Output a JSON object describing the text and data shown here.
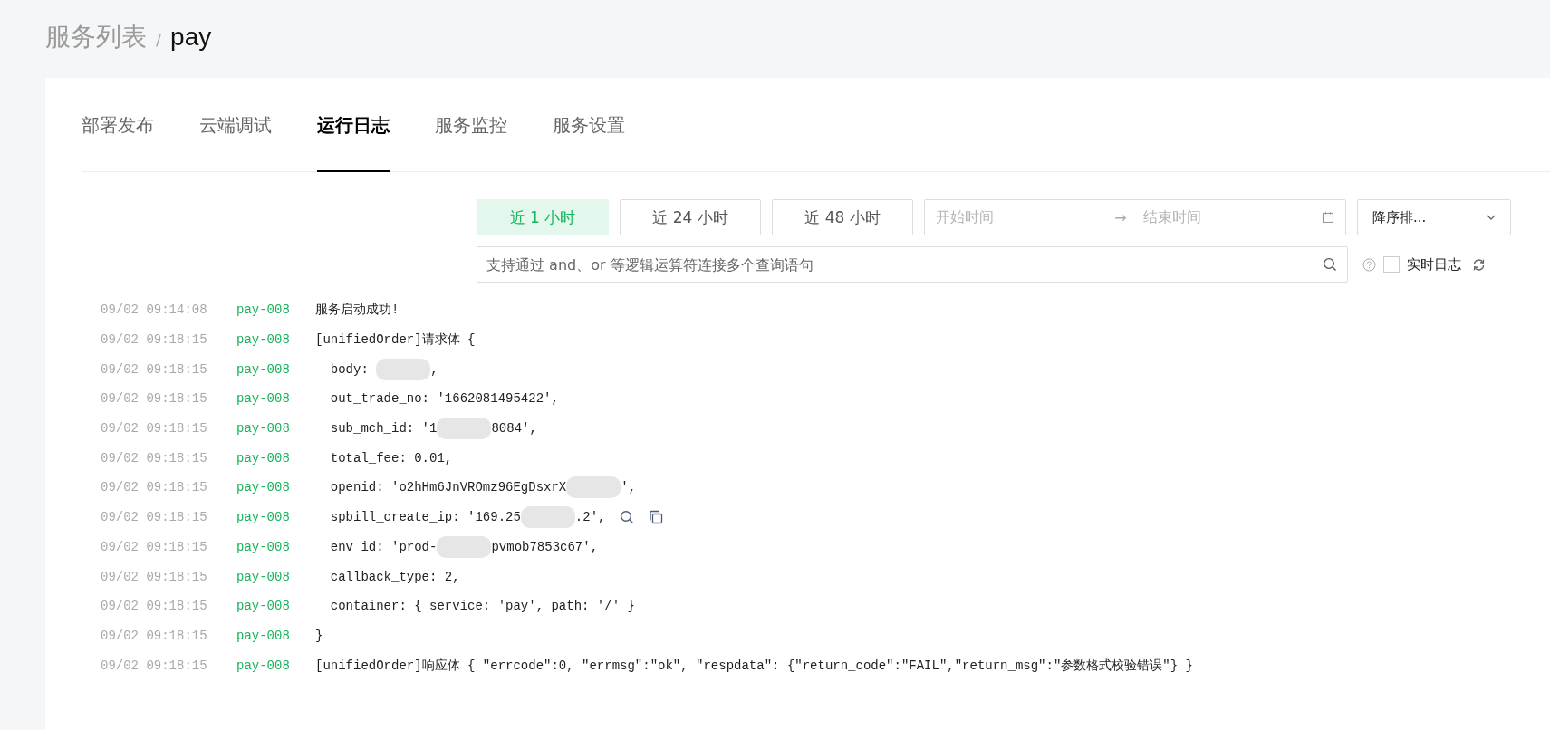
{
  "breadcrumb": {
    "parent": "服务列表",
    "separator": "/",
    "current": "pay"
  },
  "tabs": [
    {
      "label": "部署发布",
      "selected": false
    },
    {
      "label": "云端调试",
      "selected": false
    },
    {
      "label": "运行日志",
      "selected": true
    },
    {
      "label": "服务监控",
      "selected": false
    },
    {
      "label": "服务设置",
      "selected": false
    }
  ],
  "ranges": [
    {
      "label": "近 1 小时",
      "selected": true
    },
    {
      "label": "近 24 小时",
      "selected": false
    },
    {
      "label": "近 48 小时",
      "selected": false
    }
  ],
  "date_range": {
    "start_placeholder": "开始时间",
    "arrow": "→",
    "end_placeholder": "结束时间"
  },
  "sort": {
    "value": "降序排..."
  },
  "search": {
    "placeholder": "支持通过 and、or 等逻辑运算符连接多个查询语句"
  },
  "realtime": {
    "label": "实时日志",
    "checked": false
  },
  "logs": [
    {
      "time": "09/02 09:14:08",
      "source": "pay-008",
      "parts": [
        "服务启动成功!"
      ],
      "actions_shown": false
    },
    {
      "time": "09/02 09:18:15",
      "source": "pay-008",
      "parts": [
        "[unifiedOrder]请求体 {"
      ],
      "actions_shown": false
    },
    {
      "time": "09/02 09:18:15",
      "source": "pay-008",
      "parts": [
        "  body: ",
        ","
      ],
      "actions_shown": false
    },
    {
      "time": "09/02 09:18:15",
      "source": "pay-008",
      "parts": [
        "  out_trade_no: '1662081495422',"
      ],
      "actions_shown": false
    },
    {
      "time": "09/02 09:18:15",
      "source": "pay-008",
      "parts": [
        "  sub_mch_id: '1",
        "8084',"
      ],
      "actions_shown": false
    },
    {
      "time": "09/02 09:18:15",
      "source": "pay-008",
      "parts": [
        "  total_fee: 0.01,"
      ],
      "actions_shown": false
    },
    {
      "time": "09/02 09:18:15",
      "source": "pay-008",
      "parts": [
        "  openid: 'o2hHm6JnVROmz96EgDsxrX",
        "',"
      ],
      "actions_shown": false
    },
    {
      "time": "09/02 09:18:15",
      "source": "pay-008",
      "parts": [
        "  spbill_create_ip: '169.25",
        ".2',"
      ],
      "actions_shown": true
    },
    {
      "time": "09/02 09:18:15",
      "source": "pay-008",
      "parts": [
        "  env_id: 'prod-",
        "pvmob7853c67',"
      ],
      "actions_shown": false
    },
    {
      "time": "09/02 09:18:15",
      "source": "pay-008",
      "parts": [
        "  callback_type: 2,"
      ],
      "actions_shown": false
    },
    {
      "time": "09/02 09:18:15",
      "source": "pay-008",
      "parts": [
        "  container: { service: 'pay', path: '/' }"
      ],
      "actions_shown": false
    },
    {
      "time": "09/02 09:18:15",
      "source": "pay-008",
      "parts": [
        "}"
      ],
      "actions_shown": false
    },
    {
      "time": "09/02 09:18:15",
      "source": "pay-008",
      "parts": [
        "[unifiedOrder]响应体 { \"errcode\":0, \"errmsg\":\"ok\", \"respdata\": {\"return_code\":\"FAIL\",\"return_msg\":\"参数格式校验错误\"} }"
      ],
      "actions_shown": false
    }
  ]
}
